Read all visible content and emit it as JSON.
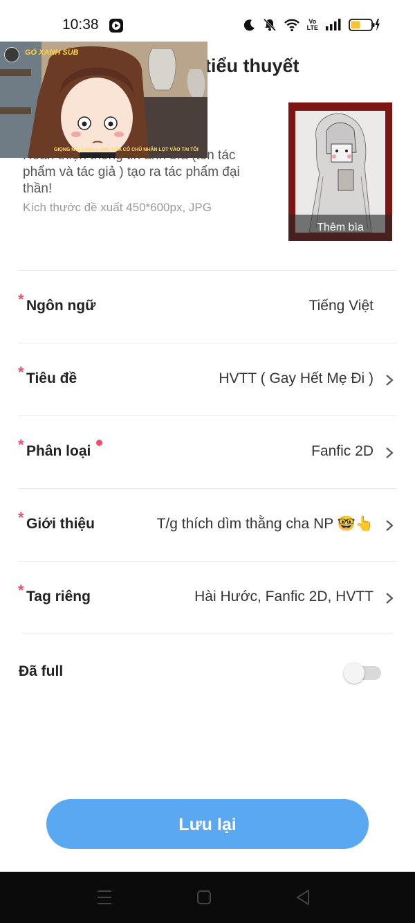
{
  "status_bar": {
    "time": "10:38",
    "volte_line1": "Vo",
    "volte_line2": "LTE",
    "battery_color": "#f4c430"
  },
  "page": {
    "title": "tiểu thuyết"
  },
  "video_overlay": {
    "channel": "GÓ XANH SUB",
    "subtitle": "GIỌNG NÓI LẠNH LÙNG CỦA CÔ CHỦ NHÂN LỌT VÀO TAI TÔI"
  },
  "cover": {
    "description": "Hoàn thiện thông tin ảnh bìa (tên tác phẩm và tác giả ) tạo ra tác phẩm đại thần!",
    "hint": "Kích thước đề xuất 450*600px, JPG",
    "add_cover_label": "Thêm bìa"
  },
  "form": {
    "required_mark": "*",
    "rows": [
      {
        "label": "Ngôn ngữ",
        "value": "Tiếng Việt"
      },
      {
        "label": "Tiêu đề",
        "value": "HVTT ( Gay Hết Mẹ Đi )"
      },
      {
        "label": "Phân loại",
        "value": "Fanfic 2D"
      },
      {
        "label": "Giới thiệu",
        "value": "T/g thích dìm thằng cha NP 🤓👆"
      },
      {
        "label": "Tag riêng",
        "value": "Hài Hước, Fanfic 2D, HVTT"
      }
    ],
    "full_label": "Đã full",
    "full_toggle_on": false
  },
  "actions": {
    "save_label": "Lưu lại"
  },
  "colors": {
    "accent": "#5aa7f2",
    "required": "#f0506e"
  }
}
